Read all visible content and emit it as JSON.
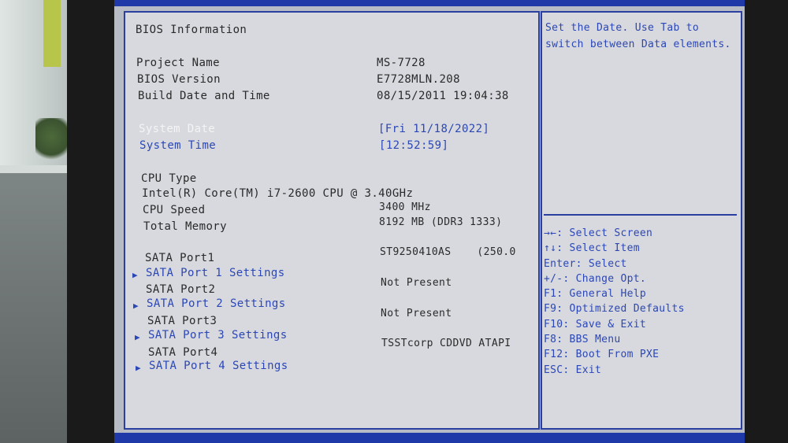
{
  "section_title": "BIOS Information",
  "info": [
    {
      "label": "Project Name",
      "value": "MS-7728"
    },
    {
      "label": "BIOS Version",
      "value": "E7728MLN.208"
    },
    {
      "label": "Build Date and Time",
      "value": "08/15/2011 19:04:38"
    }
  ],
  "system_date": {
    "label": "System Date",
    "value": "[Fri 11/18/2022]"
  },
  "system_time": {
    "label": "System Time",
    "value": "[12:52:59]"
  },
  "cpu": {
    "type_label": "CPU Type",
    "type_value": "Intel(R) Core(TM) i7-2600 CPU @ 3.40GHz",
    "speed_label": "CPU Speed",
    "speed_value": "3400 MHz",
    "memory_label": "Total Memory",
    "memory_value": "8192 MB (DDR3 1333)"
  },
  "sata": [
    {
      "label": "SATA Port1",
      "settings": "SATA Port 1 Settings",
      "value": "ST9250410AS    (250.0"
    },
    {
      "label": "SATA Port2",
      "settings": "SATA Port 2 Settings",
      "value": "Not Present"
    },
    {
      "label": "SATA Port3",
      "settings": "SATA Port 3 Settings",
      "value": "Not Present"
    },
    {
      "label": "SATA Port4",
      "settings": "SATA Port 4 Settings",
      "value": "TSSTcorp CDDVD ATAPI"
    }
  ],
  "help": {
    "line1": "Set the Date. Use Tab to",
    "line2": "switch between Data elements."
  },
  "keys": [
    "→←: Select Screen",
    "↑↓: Select Item",
    "Enter: Select",
    "+/-: Change Opt.",
    "F1: General Help",
    "F9: Optimized Defaults",
    "F10: Save & Exit",
    "F8: BBS Menu",
    "F12: Boot From PXE",
    "ESC: Exit"
  ],
  "colors": {
    "accent": "#2b47b5",
    "panel": "#d8d9df",
    "border": "#2a3fa0",
    "selected": "#f4f4f4"
  }
}
